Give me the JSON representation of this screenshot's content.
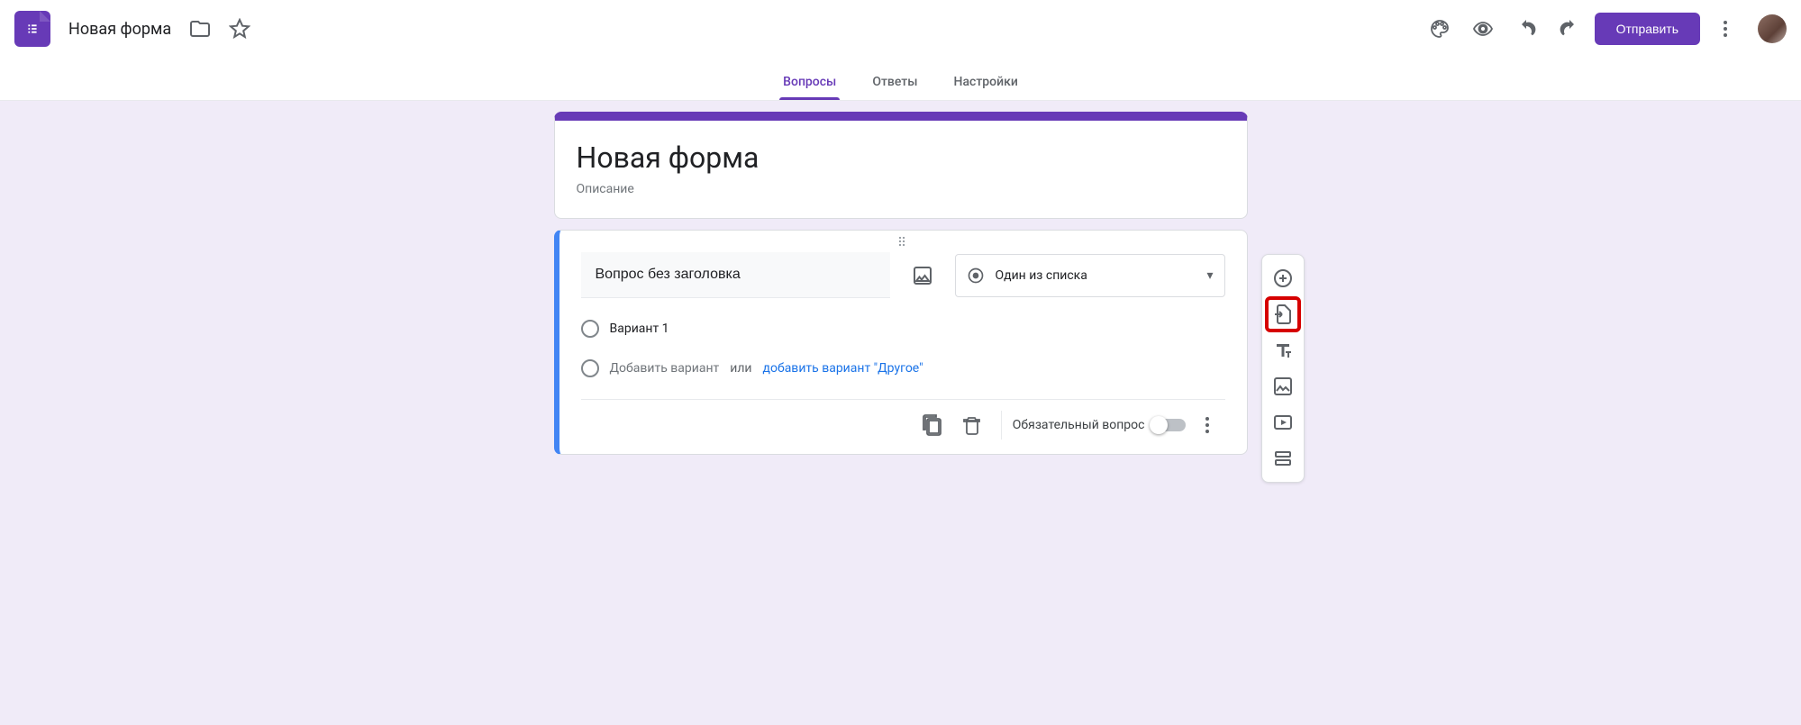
{
  "header": {
    "doc_title": "Новая форма",
    "send_label": "Отправить"
  },
  "tabs": {
    "questions": "Вопросы",
    "responses": "Ответы",
    "settings": "Настройки"
  },
  "form": {
    "title": "Новая форма",
    "description_placeholder": "Описание"
  },
  "question": {
    "title": "Вопрос без заголовка",
    "type_label": "Один из списка",
    "option1": "Вариант 1",
    "add_option": "Добавить вариант",
    "or": "или",
    "add_other": "добавить вариант \"Другое\"",
    "required_label": "Обязательный вопрос"
  },
  "icons": {
    "palette": "palette",
    "preview": "preview",
    "undo": "undo",
    "redo": "redo",
    "more": "more",
    "folder": "folder",
    "star": "star",
    "image": "image",
    "copy": "copy",
    "delete": "delete",
    "add": "add-question",
    "import": "import-questions",
    "title": "add-title",
    "add_image": "add-image",
    "video": "add-video",
    "section": "add-section"
  }
}
